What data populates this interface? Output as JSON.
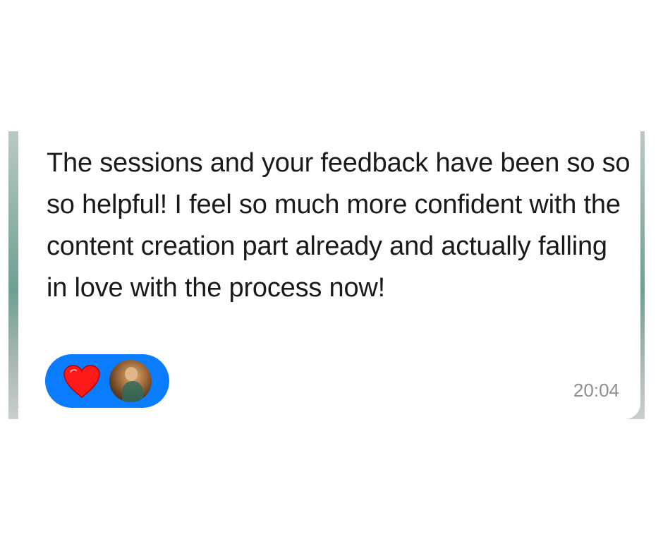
{
  "message": {
    "text": "The sessions and your feedback have been so so so helpful! I feel so much more confident with the content creation part already and actually falling in love with the process now!",
    "time": "20:04"
  },
  "reactions": {
    "emoji": "heart",
    "color": "#0a7cff",
    "heart_color": "#ff1a1a",
    "avatar_icon": "user-avatar"
  },
  "colors": {
    "bubble": "#ffffff",
    "text": "#1a1a1a",
    "timestamp": "#8e8e93"
  }
}
